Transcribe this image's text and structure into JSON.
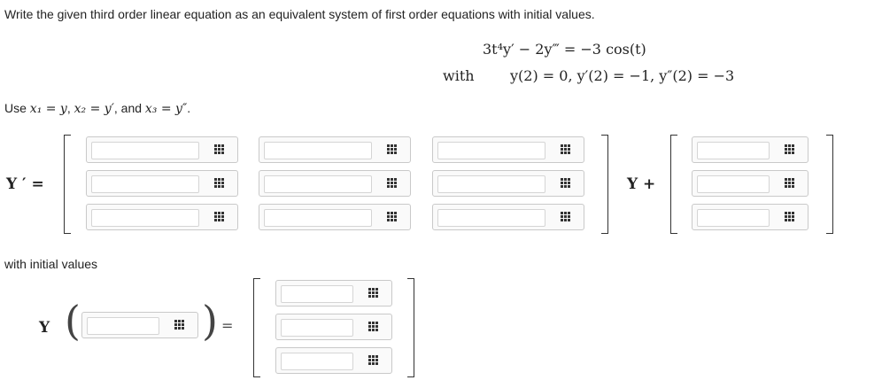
{
  "instruction": "Write the given third order linear equation as an equivalent system of first order equations with initial values.",
  "equation": {
    "main": "3t⁴y′ − 2y‴ = −3 cos(t)",
    "with_label": "with",
    "initial_conditions": "y(2) = 0,  y′(2) = −1,  y″(2) = −3"
  },
  "substitution": {
    "prefix": "Use ",
    "x1": "x₁ = y",
    "x2": "x₂ = y′",
    "and": ", and ",
    "x3": "x₃ = y″",
    "suffix": "."
  },
  "system": {
    "lhs_label": "Y ′ =",
    "plus_label": "Y +",
    "matrix_values": [
      [
        "",
        "",
        ""
      ],
      [
        "",
        "",
        ""
      ],
      [
        "",
        "",
        ""
      ]
    ],
    "vector_values": [
      "",
      "",
      ""
    ]
  },
  "initial": {
    "label": "with initial values",
    "Y_label": "Y",
    "arg_value": "",
    "equals": "=",
    "vector_values": [
      "",
      "",
      ""
    ]
  },
  "icons": {
    "keypad": "math-keypad-icon"
  }
}
